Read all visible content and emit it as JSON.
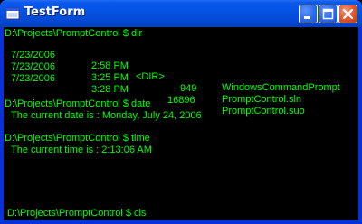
{
  "window": {
    "title": "TestForm",
    "icon": "app-window-icon",
    "buttons": [
      "minimize-icon",
      "maximize-icon",
      "close-icon"
    ]
  },
  "colors": {
    "console_bg": "#000000",
    "console_text": "#00FF00",
    "titlebar": "#0553E3",
    "close_button": "#E2532F"
  },
  "console": {
    "cmd_dir": "D:\\Projects\\PromptControl $ dir",
    "dir_entries": [
      {
        "date": "7/23/2006",
        "time": "2:58 PM",
        "size": "<DIR>",
        "name": "WindowsCommandPrompt"
      },
      {
        "date": "7/23/2006",
        "time": "3:25 PM",
        "size": "949",
        "name": "PromptControl.sln"
      },
      {
        "date": "7/23/2006",
        "time": "3:28 PM",
        "size": "16896",
        "name": "PromptControl.suo"
      }
    ],
    "cmd_date": "D:\\Projects\\PromptControl $ date",
    "date_output": "The current date is : Monday, July 24, 2006",
    "cmd_time": "D:\\Projects\\PromptControl $ time",
    "time_output": "The current time is : 2:13:06 AM",
    "current_prompt": "D:\\Projects\\PromptControl $ cls"
  }
}
